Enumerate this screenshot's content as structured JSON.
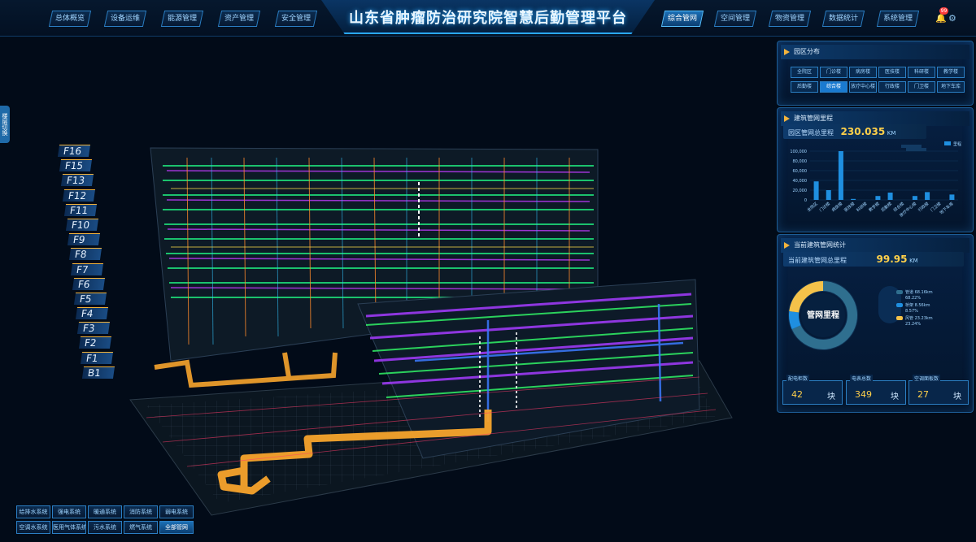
{
  "header": {
    "title": "山东省肿瘤防治研究院智慧后勤管理平台",
    "nav_left": [
      "总体概览",
      "设备运维",
      "能源管理",
      "资产管理",
      "安全管理"
    ],
    "nav_right": [
      "综合管网",
      "空间管理",
      "物资管理",
      "数据统计",
      "系统管理"
    ],
    "active_nav": "综合管网",
    "notification_count": "99"
  },
  "floors": [
    "F16",
    "F15",
    "F13",
    "F12",
    "F11",
    "F10",
    "F9",
    "F8",
    "F7",
    "F6",
    "F5",
    "F4",
    "F3",
    "F2",
    "F1",
    "B1"
  ],
  "side_tab": "楼层切换",
  "bottom_buttons": {
    "row1": [
      "给排水系统",
      "强电系统",
      "暖通系统",
      "消防系统",
      "弱电系统"
    ],
    "row2": [
      "空调水系统",
      "医用气体系统",
      "污水系统",
      "燃气系统",
      "全部管网"
    ],
    "active": "全部管网"
  },
  "region_panel": {
    "title": "园区分布",
    "row1": [
      "全院区",
      "门诊楼",
      "病房楼",
      "医技楼",
      "科研楼",
      "教学楼"
    ],
    "row2": [
      "后勤楼",
      "综合楼",
      "放疗中心楼",
      "行政楼",
      "门卫楼",
      "地下车库"
    ],
    "active": "综合楼"
  },
  "length_panel": {
    "title": "建筑管网里程",
    "label": "园区管网总里程",
    "value": "230.035",
    "unit": "KM",
    "legend": "里程",
    "colors": {
      "bar": "#1f8fe0",
      "accent": "#ffd04a"
    }
  },
  "chart_data": {
    "type": "bar",
    "categories": [
      "全院区",
      "门诊楼",
      "病房楼",
      "医技楼",
      "科研楼",
      "教学楼",
      "后勤楼",
      "综合楼",
      "放疗中心楼",
      "行政楼",
      "门卫楼",
      "地下车库"
    ],
    "values": [
      38000,
      20000,
      100000,
      2000,
      0,
      8000,
      15000,
      0,
      8000,
      16000,
      0,
      11000
    ],
    "yticks": [
      "100,000",
      "80,000",
      "60,000",
      "40,000",
      "20,000",
      "0"
    ],
    "ylim": [
      0,
      100000
    ]
  },
  "stats_panel": {
    "title": "当前建筑管网统计",
    "label": "当前建筑管网总里程",
    "value": "99.95",
    "unit": "KM",
    "donut_center": "管网里程",
    "legend": [
      {
        "name": "管道 68.16km",
        "pct": "68.22%",
        "color": "#2f6f8f"
      },
      {
        "name": "桥架 8.56km",
        "pct": "8.57%",
        "color": "#1f8fe0"
      },
      {
        "name": "风管 23.23km",
        "pct": "23.24%",
        "color": "#f4c24a"
      }
    ],
    "cards": [
      {
        "label": "配电柜数",
        "value": "42",
        "unit": "块"
      },
      {
        "label": "电表总数",
        "value": "349",
        "unit": "块"
      },
      {
        "label": "空调面板数",
        "value": "27",
        "unit": "块"
      }
    ]
  }
}
